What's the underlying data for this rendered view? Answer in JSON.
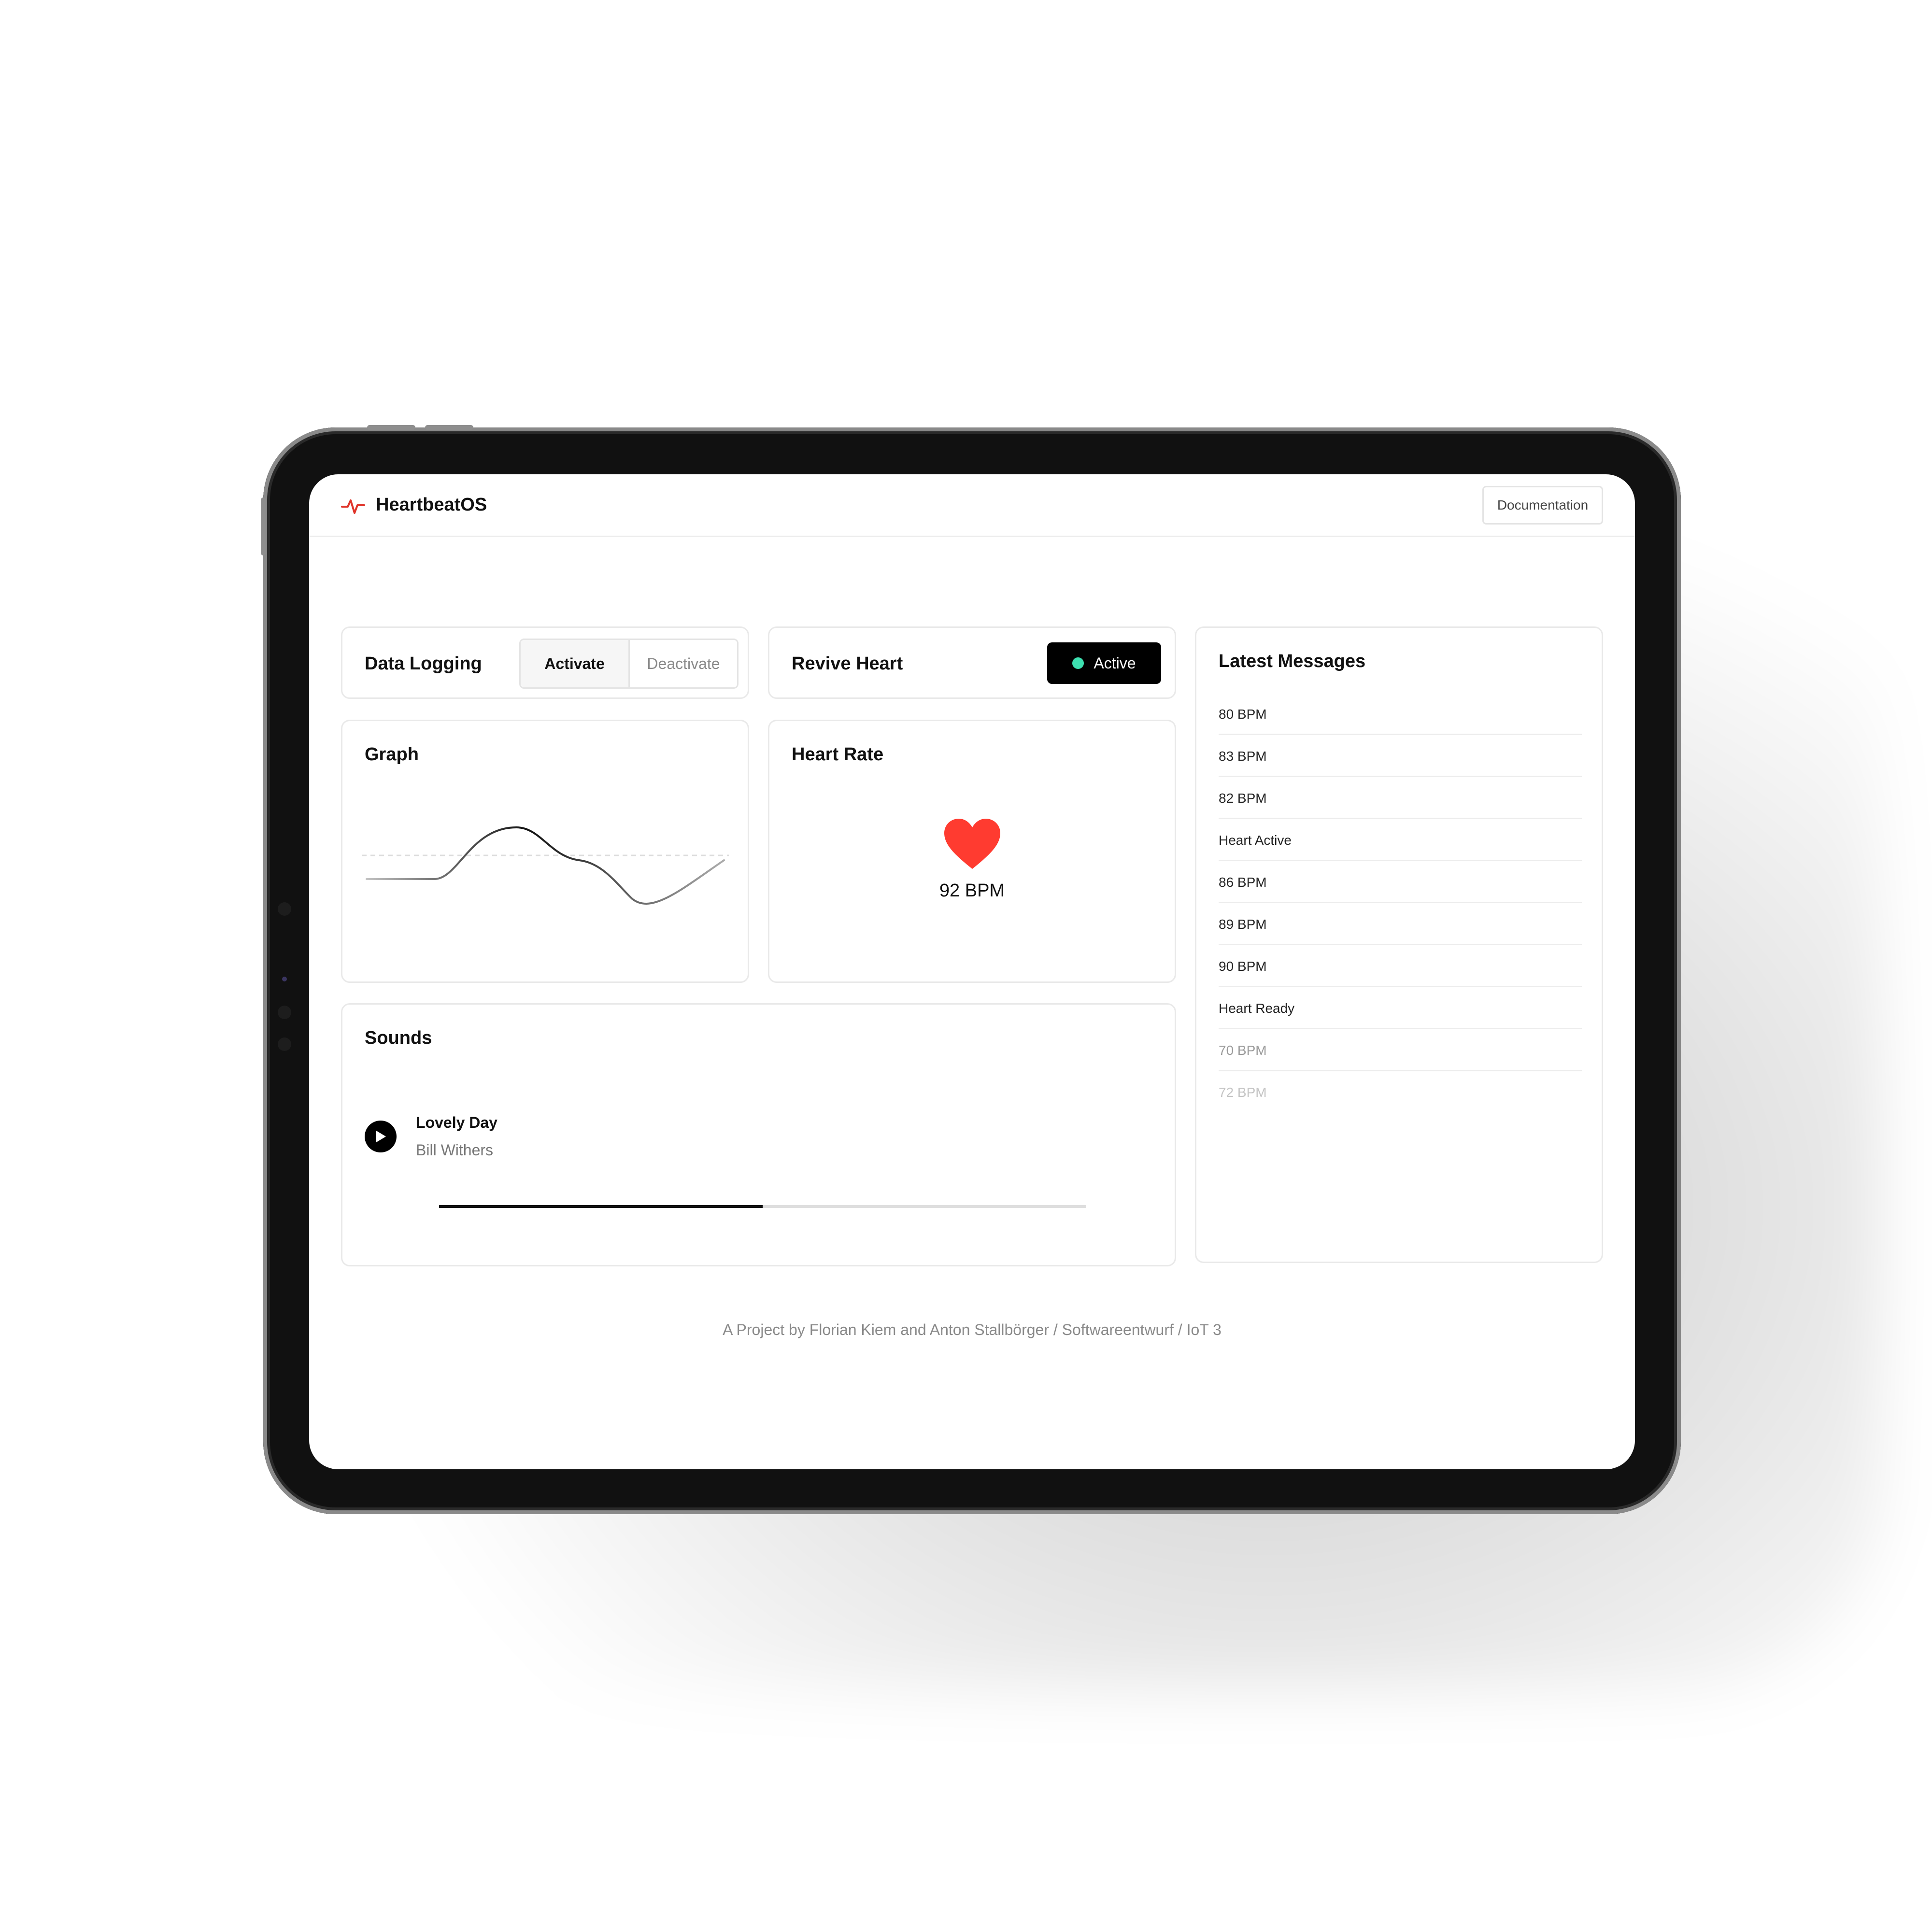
{
  "header": {
    "app_title": "HeartbeatOS",
    "documentation_label": "Documentation"
  },
  "data_logging": {
    "title": "Data Logging",
    "activate_label": "Activate",
    "deactivate_label": "Deactivate",
    "selected": "Activate"
  },
  "revive_heart": {
    "title": "Revive Heart",
    "status_label": "Active",
    "status_color": "#3de0b0"
  },
  "graph": {
    "title": "Graph"
  },
  "heart_rate": {
    "title": "Heart Rate",
    "value": "92 BPM",
    "heart_color": "#ff3b30"
  },
  "sounds": {
    "title": "Sounds",
    "track_title": "Lovely Day",
    "track_artist": "Bill Withers",
    "progress": 0.5
  },
  "messages": {
    "title": "Latest Messages",
    "items": [
      "80 BPM",
      "83 BPM",
      "82 BPM",
      "Heart Active",
      "86 BPM",
      "89 BPM",
      "90 BPM",
      "Heart Ready",
      "70 BPM",
      "72 BPM"
    ]
  },
  "footer": {
    "text": "A Project by Florian Kiem and Anton Stallbörger / Softwareentwurf / IoT 3"
  },
  "colors": {
    "accent": "#000000",
    "logo": "#e0352b"
  }
}
